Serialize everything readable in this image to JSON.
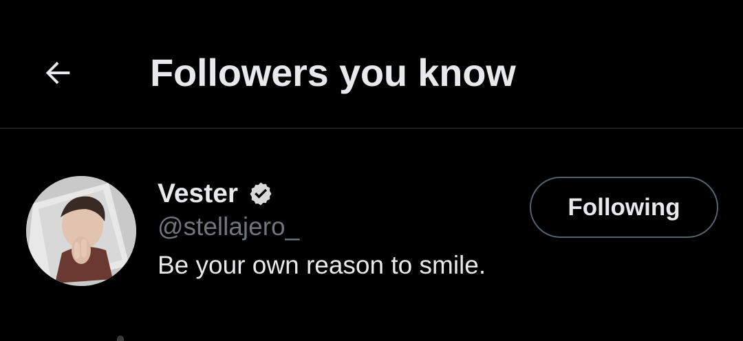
{
  "header": {
    "title": "Followers you know",
    "back_icon": "arrow-left-icon"
  },
  "user": {
    "display_name": "Vester",
    "verified_icon": "verified-badge-icon",
    "handle": "@stellajero_",
    "bio": "Be your own reason to smile.",
    "follow_button_label": "Following"
  },
  "colors": {
    "background": "#000000",
    "primary_text": "#e7e9ea",
    "secondary_text": "#71767b",
    "divider": "#2f3336",
    "button_border": "#536471"
  }
}
